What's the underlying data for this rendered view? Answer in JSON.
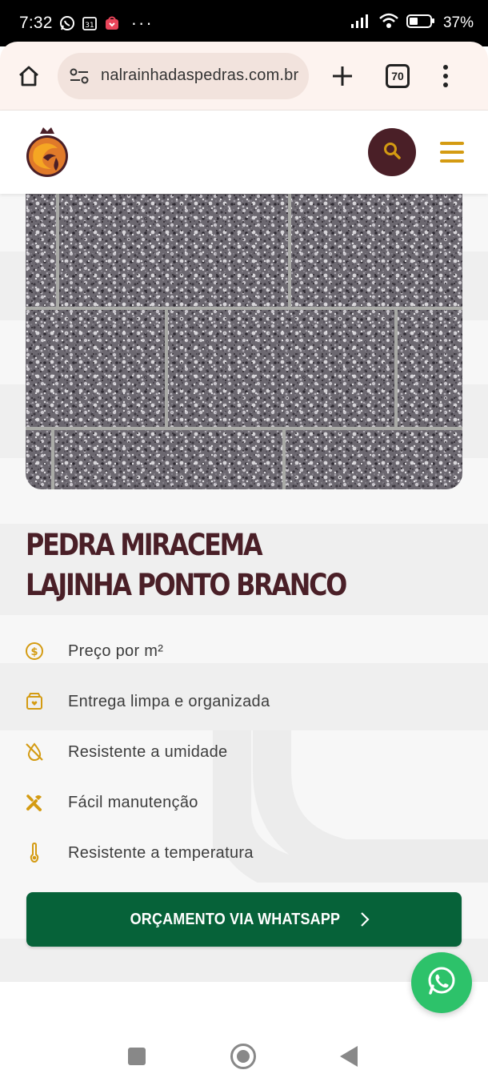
{
  "status_bar": {
    "time": "7:32",
    "calendar_day": "31",
    "more": "···",
    "battery": "37%"
  },
  "browser": {
    "url": "nalrainhadaspedras.com.br",
    "tab_count": "70",
    "icons": {
      "home": "home-icon",
      "site_settings": "tune-icon",
      "new_tab": "plus-icon",
      "menu": "more-vert-icon"
    }
  },
  "header": {
    "logo": "rainha-das-pedras-logo",
    "search_icon": "search-icon",
    "menu_icon": "hamburger-icon"
  },
  "product": {
    "title_line1": "PEDRA MIRACEMA",
    "title_line2": "LAJINHA PONTO BRANCO",
    "features": [
      {
        "icon": "dollar-circle-icon",
        "label": "Preço por m²"
      },
      {
        "icon": "box-heart-icon",
        "label": "Entrega limpa e organizada"
      },
      {
        "icon": "no-water-drop-icon",
        "label": "Resistente a umidade"
      },
      {
        "icon": "tools-icon",
        "label": "Fácil manutenção"
      },
      {
        "icon": "thermometer-icon",
        "label": "Resistente a temperatura"
      }
    ],
    "cta_label": "ORÇAMENTO VIA WHATSAPP"
  },
  "colors": {
    "brand_dark": "#4a1f27",
    "accent_gold": "#d49b12",
    "cta_green": "#066239",
    "whatsapp_green": "#2dc26a"
  }
}
